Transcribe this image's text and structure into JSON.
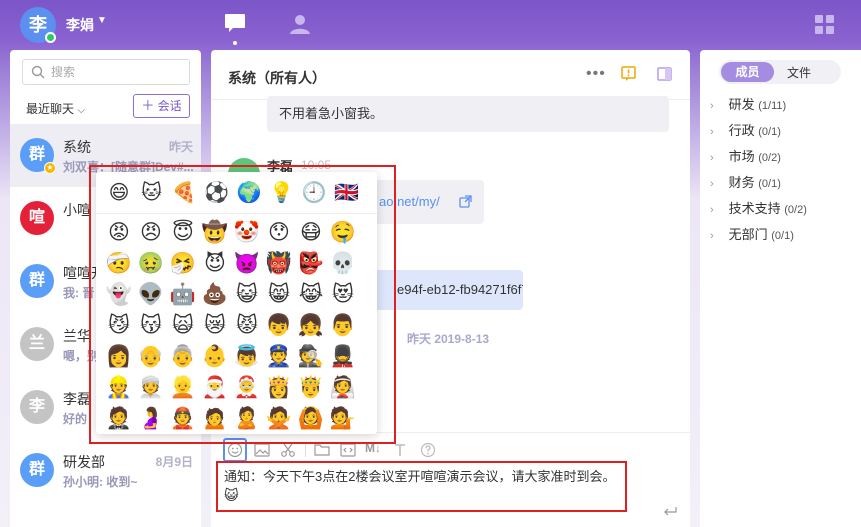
{
  "user": {
    "avatar_char": "李",
    "name": "李娟"
  },
  "colors": {
    "accent": "#7b56c8",
    "group_avatar": "#5b9ef7",
    "red_avatar": "#e3223a",
    "gray_avatar": "#c4c4c4",
    "annotation": "#e02020"
  },
  "search": {
    "placeholder": "搜索"
  },
  "recent": {
    "label": "最近聊天"
  },
  "new_chat": {
    "label": "会话"
  },
  "conversations": [
    {
      "avatar": "群",
      "name": "系统",
      "time": "昨天",
      "preview": "刘双喜：[随意群]Dev#..."
    },
    {
      "avatar": "喧",
      "name": "小喧",
      "time": "",
      "preview": ""
    },
    {
      "avatar": "群",
      "name": "喧喧开",
      "time": "",
      "preview": "我: 晋"
    },
    {
      "avatar": "兰",
      "name": "兰华",
      "time": "",
      "preview": "嗯，别"
    },
    {
      "avatar": "李",
      "name": "李磊",
      "time": "",
      "preview": "好的"
    },
    {
      "avatar": "群",
      "name": "研发部",
      "time": "8月9日",
      "preview": "孙小明: 收到~"
    }
  ],
  "chat": {
    "title": "系统（所有人）",
    "messages": [
      {
        "text": "不用着急小窗我。"
      },
      {
        "sender": "李磊",
        "time": "10:05",
        "text": "ao.net/my/"
      },
      {
        "text": "e94f-eb12-fb94271f6f7c"
      }
    ],
    "date_separator": "昨天 2019-8-13",
    "input_text": "通知：今天下午3点在2楼会议室开喧喧演示会议，请大家准时到会。",
    "input_emoji": "😺"
  },
  "emoji_picker": {
    "categories": [
      "😄",
      "🐱",
      "🍕",
      "⚽",
      "🌍",
      "💡",
      "🕘",
      "🇬🇧"
    ],
    "emojis": [
      "😡",
      "😠",
      "😇",
      "🤠",
      "🤡",
      "😯",
      "😷",
      "🤤",
      "🤕",
      "🤢",
      "🤧",
      "😈",
      "👿",
      "👹",
      "👺",
      "💀",
      "👻",
      "👽",
      "🤖",
      "💩",
      "😺",
      "😸",
      "😹",
      "😻",
      "😼",
      "😽",
      "🙀",
      "😿",
      "😾",
      "👦",
      "👧",
      "👨",
      "👩",
      "👴",
      "👵",
      "👶",
      "👼",
      "👮",
      "🕵",
      "💂",
      "👷",
      "👳",
      "👱",
      "🎅",
      "🤶",
      "👸",
      "🤴",
      "👰",
      "🤵",
      "🤰",
      "👲",
      "🙍",
      "🙎",
      "🙅",
      "🙆",
      "💁"
    ]
  },
  "toolbar": {
    "markdown": "M↓"
  },
  "members": {
    "tab_active": "成员",
    "tab_other": "文件",
    "departments": [
      {
        "name": "研发",
        "count": "(1/11)"
      },
      {
        "name": "行政",
        "count": "(0/1)"
      },
      {
        "name": "市场",
        "count": "(0/2)"
      },
      {
        "name": "财务",
        "count": "(0/1)"
      },
      {
        "name": "技术支持",
        "count": "(0/2)"
      },
      {
        "name": "无部门",
        "count": "(0/1)"
      }
    ]
  }
}
